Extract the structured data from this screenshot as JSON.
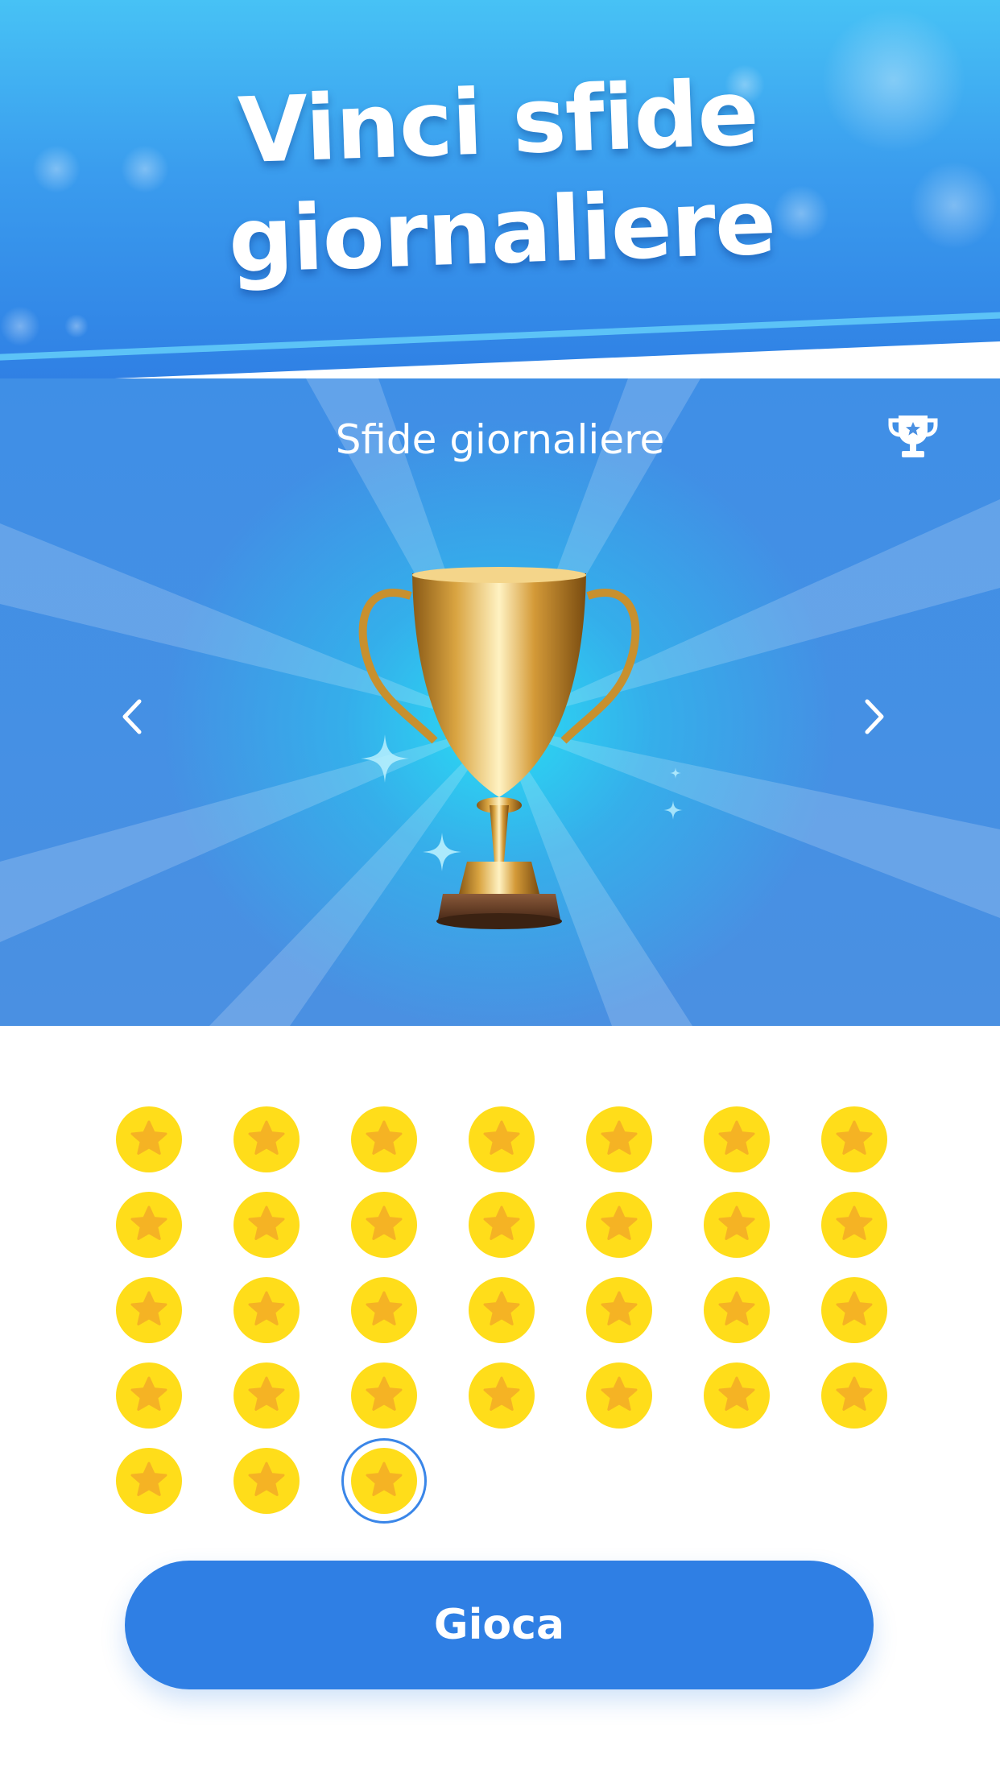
{
  "banner": {
    "headline_line1": "Vinci sfide",
    "headline_line2": "giornaliere"
  },
  "hero": {
    "title": "Sfide giornaliere",
    "trophy_icon": "trophy-icon",
    "prev_icon": "chevron-left-icon",
    "next_icon": "chevron-right-icon"
  },
  "stars": {
    "completed_count": 31,
    "current_index": 31,
    "coin_color": "#ffdd1a",
    "star_color": "#f5b324",
    "highlight_color": "#3a86e8"
  },
  "play_button": {
    "label": "Gioca"
  },
  "colors": {
    "accent": "#2f7fe4"
  }
}
